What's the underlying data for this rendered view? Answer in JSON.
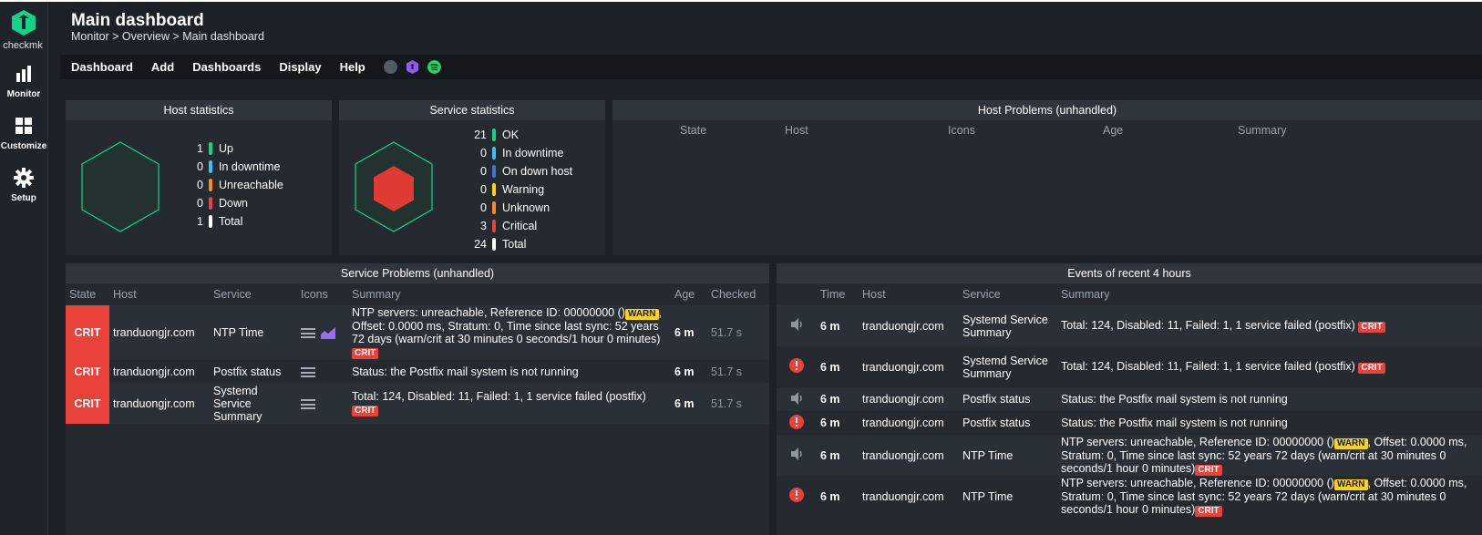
{
  "sidebar": {
    "logo_text": "checkmk",
    "items": [
      {
        "label": "Monitor"
      },
      {
        "label": "Customize"
      },
      {
        "label": "Setup"
      }
    ]
  },
  "header": {
    "title": "Main dashboard",
    "breadcrumb": "Monitor > Overview > Main dashboard"
  },
  "menubar": {
    "items": [
      "Dashboard",
      "Add",
      "Dashboards",
      "Display",
      "Help"
    ],
    "icon_names": [
      "globe-icon",
      "checkmk-cube-icon",
      "spotify-icon"
    ]
  },
  "colors": {
    "ok": "#13d389",
    "downtime": "#3cc1f2",
    "unreachable": "#ff8a1f",
    "down": "#e8423a",
    "total": "#ffffff",
    "on_down_host": "#3f74d1",
    "warning": "#ffd21a",
    "unknown": "#ff8a1f",
    "critical": "#e8423a"
  },
  "host_stats": {
    "title": "Host statistics",
    "rows": [
      {
        "num": "1",
        "label": "Up"
      },
      {
        "num": "0",
        "label": "In downtime"
      },
      {
        "num": "0",
        "label": "Unreachable"
      },
      {
        "num": "0",
        "label": "Down"
      },
      {
        "num": "1",
        "label": "Total"
      }
    ]
  },
  "service_stats": {
    "title": "Service statistics",
    "rows": [
      {
        "num": "21",
        "label": "OK"
      },
      {
        "num": "0",
        "label": "In downtime"
      },
      {
        "num": "0",
        "label": "On down host"
      },
      {
        "num": "0",
        "label": "Warning"
      },
      {
        "num": "0",
        "label": "Unknown"
      },
      {
        "num": "3",
        "label": "Critical"
      },
      {
        "num": "24",
        "label": "Total"
      }
    ]
  },
  "host_problems": {
    "title": "Host Problems (unhandled)",
    "columns": [
      "State",
      "Host",
      "Icons",
      "Age",
      "Summary"
    ]
  },
  "service_problems": {
    "title": "Service Problems (unhandled)",
    "columns": [
      "State",
      "Host",
      "Service",
      "Icons",
      "Summary",
      "Age",
      "Checked"
    ],
    "rows": [
      {
        "state": "CRIT",
        "host": "tranduongjr.com",
        "service": "NTP Time",
        "summary_a": "NTP servers: unreachable, Reference ID: 00000000 ()",
        "warn": "WARN",
        "summary_b": ", Offset: 0.0000 ms, Stratum: 0, Time since last sync: 52 years 72 days (warn/crit at 30 minutes 0 seconds/1 hour 0 minutes)",
        "crit": "CRIT",
        "age": "6 m",
        "checked": "51.7 s"
      },
      {
        "state": "CRIT",
        "host": "tranduongjr.com",
        "service": "Postfix status",
        "summary_a": "Status: the Postfix mail system is not running",
        "age": "6 m",
        "checked": "51.7 s"
      },
      {
        "state": "CRIT",
        "host": "tranduongjr.com",
        "service": "Systemd Service Summary",
        "summary_a": "Total: 124, Disabled: 11, Failed: 1, 1 service failed (postfix)",
        "crit": "CRIT",
        "age": "6 m",
        "checked": "51.7 s"
      }
    ]
  },
  "events": {
    "title": "Events of recent 4 hours",
    "columns": [
      "Time",
      "Host",
      "Service",
      "Summary"
    ],
    "rows": [
      {
        "icon": "speaker-icon",
        "time": "6 m",
        "host": "tranduongjr.com",
        "service": "Systemd Service Summary",
        "summary_a": "Total: 124, Disabled: 11, Failed: 1, 1 service failed (postfix)",
        "crit": "CRIT"
      },
      {
        "icon": "alert-icon",
        "time": "6 m",
        "host": "tranduongjr.com",
        "service": "Systemd Service Summary",
        "summary_a": "Total: 124, Disabled: 11, Failed: 1, 1 service failed (postfix)",
        "crit": "CRIT"
      },
      {
        "icon": "speaker-icon",
        "time": "6 m",
        "host": "tranduongjr.com",
        "service": "Postfix status",
        "summary_a": "Status: the Postfix mail system is not running"
      },
      {
        "icon": "alert-icon",
        "time": "6 m",
        "host": "tranduongjr.com",
        "service": "Postfix status",
        "summary_a": "Status: the Postfix mail system is not running"
      },
      {
        "icon": "speaker-icon",
        "time": "6 m",
        "host": "tranduongjr.com",
        "service": "NTP Time",
        "summary_a": "NTP servers: unreachable, Reference ID: 00000000 ()",
        "warn": "WARN",
        "summary_b": ", Offset: 0.0000 ms, Stratum: 0, Time since last sync: 52 years 72 days (warn/crit at 30 minutes 0 seconds/1 hour 0 minutes)",
        "crit": "CRIT"
      },
      {
        "icon": "alert-icon",
        "time": "6 m",
        "host": "tranduongjr.com",
        "service": "NTP Time",
        "summary_a": "NTP servers: unreachable, Reference ID: 00000000 ()",
        "warn": "WARN",
        "summary_b": ", Offset: 0.0000 ms, Stratum: 0, Time since last sync: 52 years 72 days (warn/crit at 30 minutes 0 seconds/1 hour 0 minutes)",
        "crit": "CRIT"
      }
    ]
  }
}
